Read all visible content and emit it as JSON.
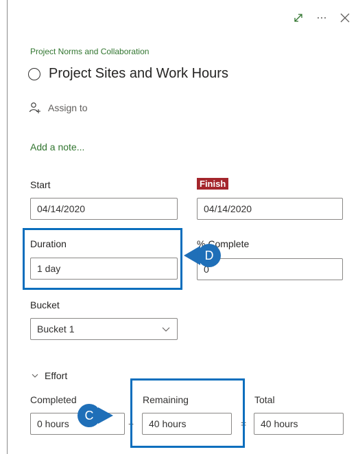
{
  "header": {
    "expand_icon": "expand-icon",
    "more_icon": "more-icon",
    "close_icon": "close-icon"
  },
  "breadcrumb": "Project Norms and Collaboration",
  "task": {
    "title": "Project Sites and Work Hours"
  },
  "assign": {
    "label": "Assign to"
  },
  "note": {
    "label": "Add a note..."
  },
  "dates": {
    "start_label": "Start",
    "start_value": "04/14/2020",
    "finish_label": "Finish",
    "finish_value": "04/14/2020"
  },
  "duration": {
    "label": "Duration",
    "value": "1 day"
  },
  "percent": {
    "label": "% Complete",
    "value": "0"
  },
  "bucket": {
    "label": "Bucket",
    "value": "Bucket 1"
  },
  "effort": {
    "label": "Effort",
    "completed_label": "Completed",
    "completed_value": "0 hours",
    "remaining_label": "Remaining",
    "remaining_value": "40 hours",
    "total_label": "Total",
    "total_value": "40 hours",
    "plus": "+",
    "equals": "="
  },
  "callouts": {
    "d": "D",
    "c": "C"
  },
  "colors": {
    "accent_green": "#31752f",
    "finish_red": "#a4262c",
    "callout_blue": "#0a6ebd"
  }
}
